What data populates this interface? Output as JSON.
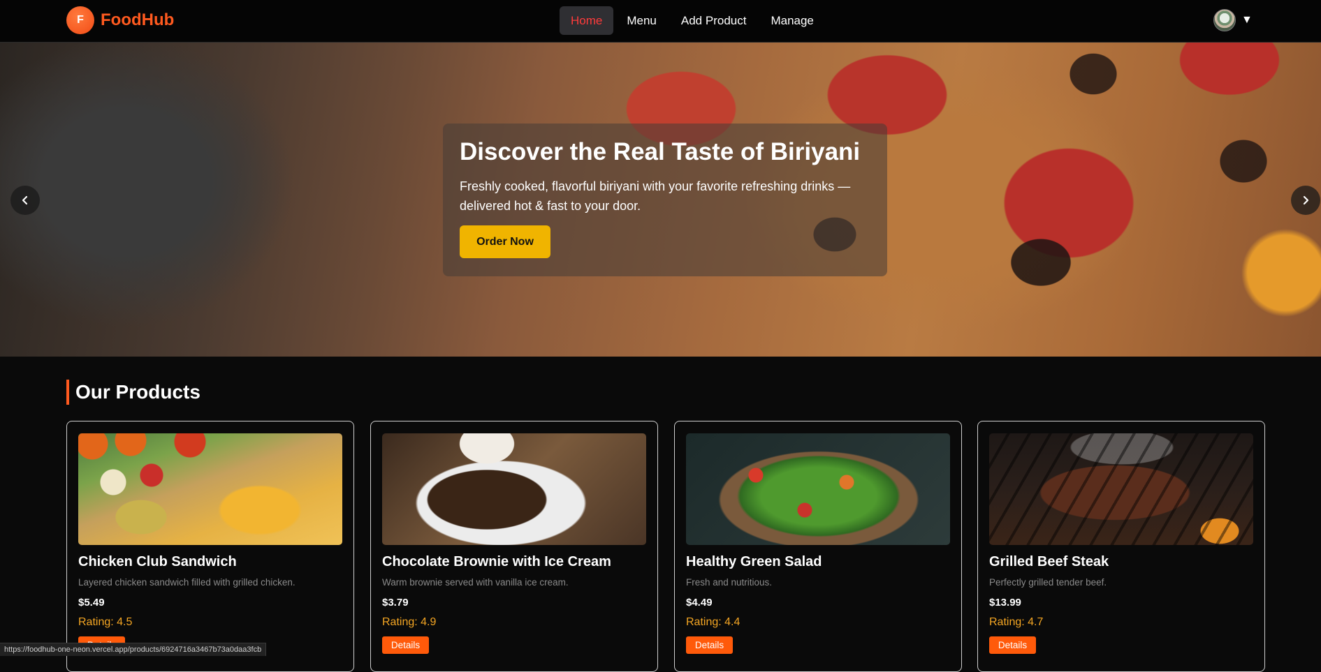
{
  "brand": {
    "logo_letter": "F",
    "name": "FoodHub"
  },
  "nav": {
    "items": [
      {
        "label": "Home",
        "active": true
      },
      {
        "label": "Menu",
        "active": false
      },
      {
        "label": "Add Product",
        "active": false
      },
      {
        "label": "Manage",
        "active": false
      }
    ],
    "avatar_caret": "▼"
  },
  "hero": {
    "title": "Discover the Real Taste of Biriyani",
    "subtitle": "Freshly cooked, flavorful biriyani with your favorite refreshing drinks — delivered hot & fast to your door.",
    "cta": "Order Now",
    "prev_icon": "chevron-left-icon",
    "next_icon": "chevron-right-icon"
  },
  "products": {
    "heading": "Our Products",
    "items": [
      {
        "title": "Chicken Club Sandwich",
        "description": "Layered chicken sandwich filled with grilled chicken.",
        "price": "$5.49",
        "rating": "Rating: 4.5",
        "button": "Details"
      },
      {
        "title": "Chocolate Brownie with Ice Cream",
        "description": "Warm brownie served with vanilla ice cream.",
        "price": "$3.79",
        "rating": "Rating: 4.9",
        "button": "Details"
      },
      {
        "title": "Healthy Green Salad",
        "description": "Fresh and nutritious.",
        "price": "$4.49",
        "rating": "Rating: 4.4",
        "button": "Details"
      },
      {
        "title": "Grilled Beef Steak",
        "description": "Perfectly grilled tender beef.",
        "price": "$13.99",
        "rating": "Rating: 4.7",
        "button": "Details"
      }
    ]
  },
  "status_bar": {
    "url": "https://foodhub-one-neon.vercel.app/products/6924716a3467b73a0daa3fcb"
  },
  "colors": {
    "brand": "#ff5a1f",
    "active_nav": "#ff3b3b",
    "cta": "#f0b400",
    "rating": "#f5a623",
    "details_button": "#ff5a0a"
  }
}
